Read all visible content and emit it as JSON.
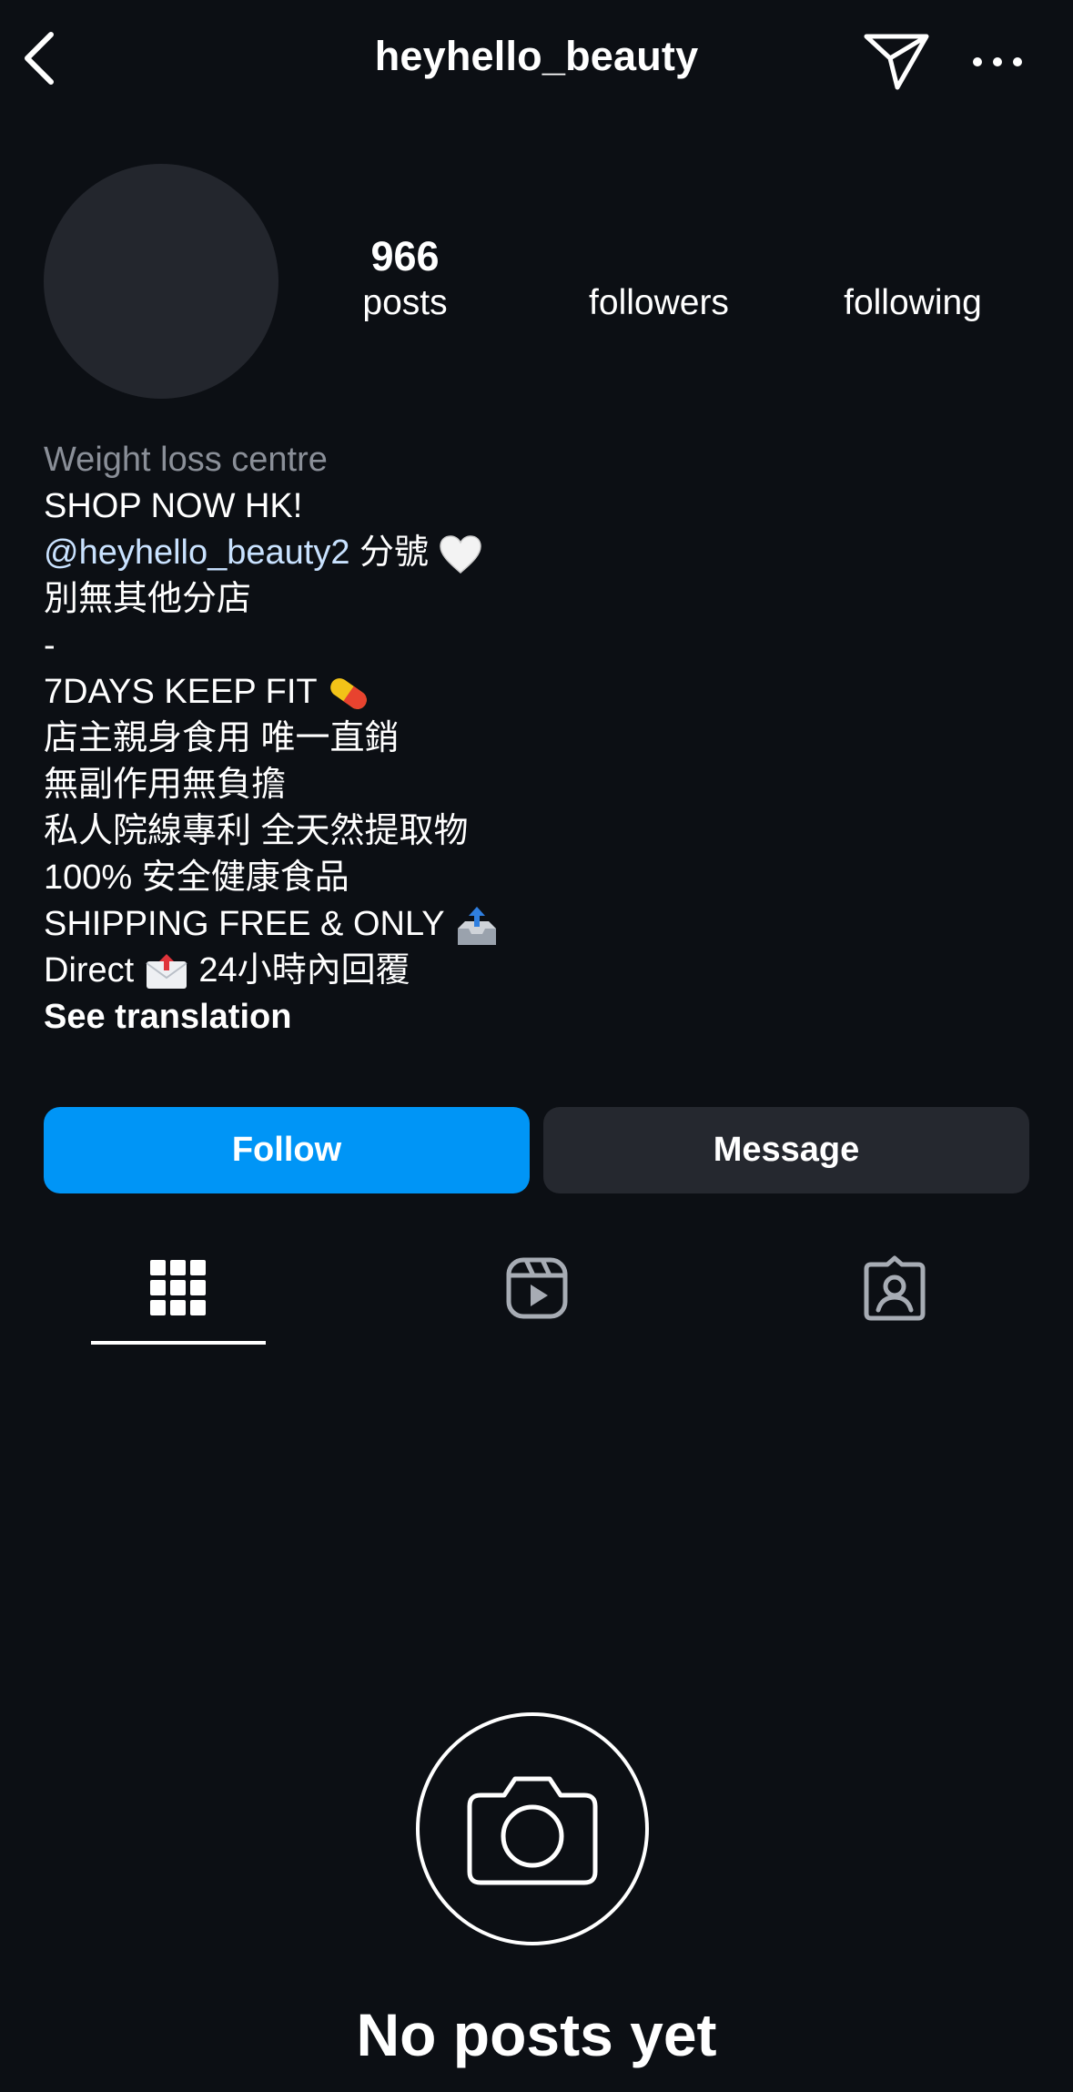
{
  "header": {
    "username": "heyhello_beauty"
  },
  "stats": {
    "posts_count": "966",
    "posts_label": "posts",
    "followers_label": "followers",
    "following_label": "following"
  },
  "bio": {
    "category": "Weight loss centre",
    "lines": {
      "line1": "SHOP NOW HK!",
      "mention": "@heyhello_beauty2",
      "mention_suffix": " 分號",
      "line3": "別無其他分店",
      "line4": "-",
      "line5": "7DAYS KEEP FIT ",
      "line6": "店主親身食用 唯一直銷",
      "line7": "無副作用無負擔",
      "line8": "私人院線專利 全天然提取物",
      "line9": "100% 安全健康食品",
      "line10": "SHIPPING FREE & ONLY ",
      "line11a": "Direct ",
      "line11b": " 24小時內回覆"
    },
    "see_translation": "See translation"
  },
  "actions": {
    "follow_label": "Follow",
    "message_label": "Message"
  },
  "tabs": {
    "active": "grid",
    "icons": [
      "grid-icon",
      "reels-icon",
      "tagged-icon"
    ]
  },
  "empty_state": {
    "text": "No posts yet",
    "icon": "camera-icon"
  },
  "colors": {
    "background": "#0c0f14",
    "follow_button": "#0095f6",
    "message_button": "#25282f",
    "mention": "#c9e2ff",
    "category": "#8a8f98"
  }
}
